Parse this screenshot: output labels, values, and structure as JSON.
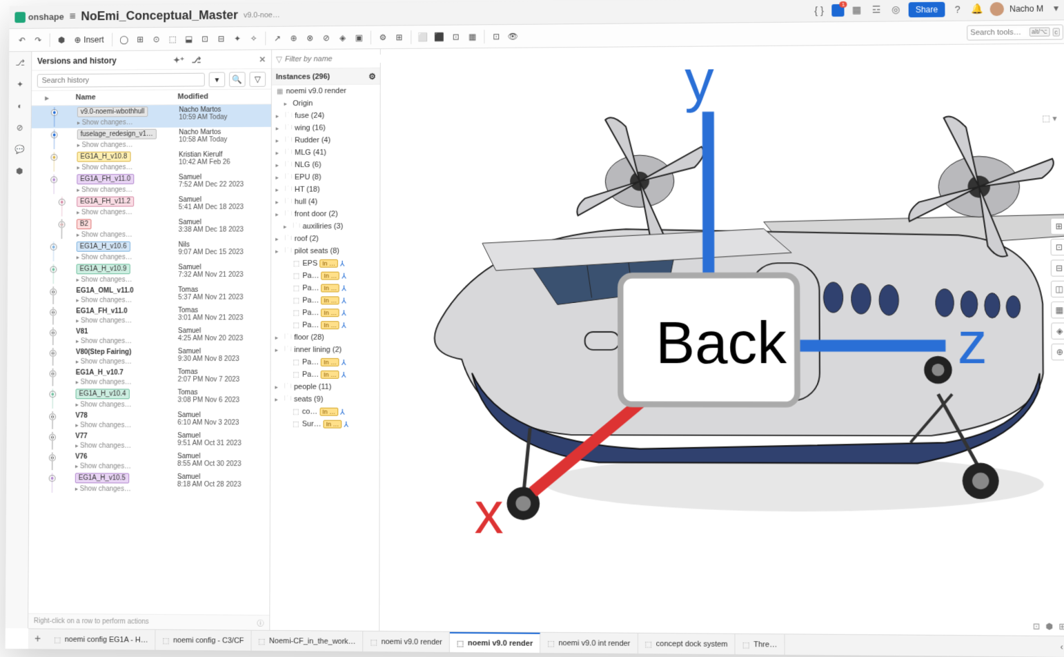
{
  "brand": "onshape",
  "doc_title": "NoEmi_Conceptual_Master",
  "doc_branch": "v9.0-noe…",
  "titlebar": {
    "share": "Share",
    "user": "Nacho M",
    "search_placeholder": "Search tools…",
    "kbd1": "alt/⌥",
    "kbd2": "c"
  },
  "toolbar": {
    "insert": "Insert"
  },
  "version_panel": {
    "title": "Versions and history",
    "search_placeholder": "Search history",
    "col_name": "Name",
    "col_modified": "Modified",
    "show_changes": "Show changes…",
    "footer": "Right-click on a row to perform actions",
    "items": [
      {
        "label": "v9.0-noemi-wbothhull",
        "color": "lc-gray",
        "user": "Nacho Martos",
        "time": "10:59 AM Today",
        "active": true,
        "dot": "#1b68d4",
        "lane": 2
      },
      {
        "label": "fuselage_redesign_v1…",
        "color": "lc-gray",
        "user": "Nacho Martos",
        "time": "10:58 AM Today",
        "dot": "#1b68d4",
        "lane": 2
      },
      {
        "label": "EG1A_H_v10.8",
        "color": "lc-yellow",
        "user": "Kristian Kierulf",
        "time": "10:42 AM Feb 26",
        "dot": "#d9b347",
        "lane": 2
      },
      {
        "label": "EG1A_FH_v11.0",
        "color": "lc-purple",
        "user": "Samuel",
        "time": "7:52 AM Dec 22 2023",
        "dot": "#b38acf",
        "lane": 2
      },
      {
        "label": "EG1A_FH_v11.2",
        "color": "lc-pink",
        "user": "Samuel",
        "time": "5:41 AM Dec 18 2023",
        "dot": "#d68ba6",
        "lane": 3
      },
      {
        "label": "B2",
        "color": "lc-red",
        "user": "Samuel",
        "time": "3:38 AM Dec 18 2023",
        "dot": "#d77",
        "lane": 3
      },
      {
        "label": "EG1A_H_v10.6",
        "color": "lc-blue",
        "user": "Nils",
        "time": "9:07 AM Dec 15 2023",
        "dot": "#7ab1df",
        "lane": 2
      },
      {
        "label": "EG1A_H_v10.9",
        "color": "lc-teal",
        "user": "Samuel",
        "time": "7:32 AM Nov 21 2023",
        "dot": "#6fbf9e",
        "lane": 2
      },
      {
        "label": "EG1A_OML_v11.0",
        "color": "lc-none",
        "user": "Tomas",
        "time": "5:37 AM Nov 21 2023",
        "dot": "#333",
        "lane": 2
      },
      {
        "label": "EG1A_FH_v11.0",
        "color": "lc-none",
        "user": "Tomas",
        "time": "3:01 AM Nov 21 2023",
        "dot": "#333",
        "lane": 2
      },
      {
        "label": "V81",
        "color": "lc-none",
        "user": "Samuel",
        "time": "4:25 AM Nov 20 2023",
        "dot": "#333",
        "lane": 2
      },
      {
        "label": "V80(Step Fairing)",
        "color": "lc-none",
        "user": "Samuel",
        "time": "9:30 AM Nov 8 2023",
        "dot": "#333",
        "lane": 2
      },
      {
        "label": "EG1A_H_v10.7",
        "color": "lc-none",
        "user": "Tomas",
        "time": "2:07 PM Nov 7 2023",
        "dot": "#333",
        "lane": 2
      },
      {
        "label": "EG1A_H_v10.4",
        "color": "lc-teal",
        "user": "Tomas",
        "time": "3:08 PM Nov 6 2023",
        "dot": "#6fbf9e",
        "lane": 2
      },
      {
        "label": "V78",
        "color": "lc-none",
        "user": "Samuel",
        "time": "6:10 AM Nov 3 2023",
        "dot": "#333",
        "lane": 2
      },
      {
        "label": "V77",
        "color": "lc-none",
        "user": "Samuel",
        "time": "9:51 AM Oct 31 2023",
        "dot": "#333",
        "lane": 2
      },
      {
        "label": "V76",
        "color": "lc-none",
        "user": "Samuel",
        "time": "8:55 AM Oct 30 2023",
        "dot": "#333",
        "lane": 2
      },
      {
        "label": "EG1A_H_v10.5",
        "color": "lc-purple",
        "user": "Samuel",
        "time": "8:18 AM Oct 28 2023",
        "dot": "#b38acf",
        "lane": 2
      }
    ]
  },
  "instances": {
    "filter_placeholder": "Filter by name",
    "header": "Instances (296)",
    "root": "noemi v9.0 render",
    "origin": "Origin",
    "items": [
      {
        "name": "fuse (24)",
        "type": "folder",
        "exp": true
      },
      {
        "name": "wing (16)",
        "type": "folder",
        "exp": true
      },
      {
        "name": "Rudder (4)",
        "type": "folder",
        "exp": true
      },
      {
        "name": "MLG (41)",
        "type": "folder",
        "exp": true
      },
      {
        "name": "NLG (6)",
        "type": "folder",
        "exp": true
      },
      {
        "name": "EPU (8)",
        "type": "folder",
        "exp": true
      },
      {
        "name": "HT (18)",
        "type": "folder",
        "exp": true
      },
      {
        "name": "hull (4)",
        "type": "folder",
        "exp": true
      },
      {
        "name": "front door (2)",
        "type": "folder",
        "exp": true
      },
      {
        "name": "auxiliries (3)",
        "type": "folder",
        "exp": true,
        "indent": 1
      },
      {
        "name": "roof (2)",
        "type": "folder",
        "exp": true
      },
      {
        "name": "pilot seats (8)",
        "type": "folder",
        "exp": true
      },
      {
        "name": "EPS",
        "type": "part",
        "pill": "In …",
        "mate": true,
        "indent": 1
      },
      {
        "name": "Pa…",
        "type": "part",
        "pill": "In …",
        "mate": true,
        "indent": 1
      },
      {
        "name": "Pa…",
        "type": "part",
        "pill": "In …",
        "mate": true,
        "indent": 1
      },
      {
        "name": "Pa…",
        "type": "part",
        "pill": "In …",
        "mate": true,
        "indent": 1
      },
      {
        "name": "Pa…",
        "type": "part",
        "pill": "In …",
        "mate": true,
        "indent": 1
      },
      {
        "name": "Pa…",
        "type": "part",
        "pill": "In …",
        "mate": true,
        "indent": 1
      },
      {
        "name": "floor (28)",
        "type": "folder",
        "exp": true
      },
      {
        "name": "inner lining (2)",
        "type": "folder",
        "exp": true
      },
      {
        "name": "Pa…",
        "type": "part",
        "pill": "In …",
        "mate": true,
        "indent": 1
      },
      {
        "name": "Pa…",
        "type": "part",
        "pill": "In …",
        "mate": true,
        "indent": 1
      },
      {
        "name": "people (11)",
        "type": "folder",
        "exp": true
      },
      {
        "name": "seats (9)",
        "type": "folder",
        "exp": true
      },
      {
        "name": "co…",
        "type": "part",
        "pill": "In …",
        "mate": true,
        "indent": 1
      },
      {
        "name": "Sur…",
        "type": "part",
        "pill": "In …",
        "mate": true,
        "indent": 1
      }
    ]
  },
  "viewcube": {
    "label": "Back",
    "x": "x",
    "y": "y",
    "z": "z"
  },
  "tabs": {
    "items": [
      {
        "name": "noemi config EG1A - H…",
        "active": false
      },
      {
        "name": "noemi config - C3/CF",
        "active": false
      },
      {
        "name": "Noemi-CF_in_the_work…",
        "active": false
      },
      {
        "name": "noemi v9.0 render",
        "active": false
      },
      {
        "name": "noemi v9.0 render",
        "active": true
      },
      {
        "name": "noemi v9.0 int render",
        "active": false
      },
      {
        "name": "concept dock system",
        "active": false
      },
      {
        "name": "Thre…",
        "active": false
      }
    ]
  }
}
